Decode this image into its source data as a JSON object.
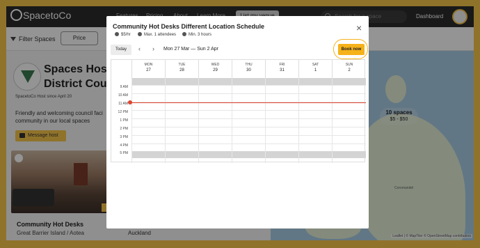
{
  "nav": {
    "logo_text": "SpacetoCo",
    "links": [
      "Features",
      "Pricing",
      "About",
      "Learn More"
    ],
    "list_venue": "List my venue",
    "search_placeholder": "Search for a space",
    "dashboard": "Dashboard"
  },
  "filters": {
    "label": "Filter Spaces",
    "price": "Price"
  },
  "host": {
    "title": "Spaces Host District Cou",
    "since": "SpacetoCo Host since April 20",
    "description": "Friendly and welcoming council faci community in our local spaces",
    "message_button": "Message host"
  },
  "cards": [
    {
      "title": "Community Hot Desks",
      "location": "Great Barrier Island / Aotea"
    },
    {
      "title": "",
      "location": "Auckland"
    }
  ],
  "map": {
    "pin_label": "10 spaces",
    "pin_price": "$5 - $50",
    "place_label": "Coromandel",
    "attribution": "Leaflet | © MapTiler © OpenStreetMap contributors"
  },
  "modal": {
    "title": "Community Hot Desks Different Location Schedule",
    "price": "$5/hr",
    "attendees": "Max. 1 attendees",
    "min_hours": "Min. 3 hours",
    "today": "Today",
    "range": "Mon 27 Mar — Sun 2 Apr",
    "book_now": "Book now",
    "days": [
      {
        "name": "MON",
        "date": "27"
      },
      {
        "name": "TUE",
        "date": "28"
      },
      {
        "name": "WED",
        "date": "29"
      },
      {
        "name": "THU",
        "date": "30"
      },
      {
        "name": "FRI",
        "date": "31"
      },
      {
        "name": "SAT",
        "date": "1"
      },
      {
        "name": "SUN",
        "date": "2"
      }
    ],
    "hours": [
      "9 AM",
      "10 AM",
      "11 AM",
      "12 PM",
      "1 PM",
      "2 PM",
      "3 PM",
      "4 PM",
      "5 PM"
    ]
  },
  "colors": {
    "accent": "#f9c74a",
    "book_button": "#f5b21a",
    "now_line": "#e0442f",
    "nav_bg": "#2b2b2b"
  }
}
